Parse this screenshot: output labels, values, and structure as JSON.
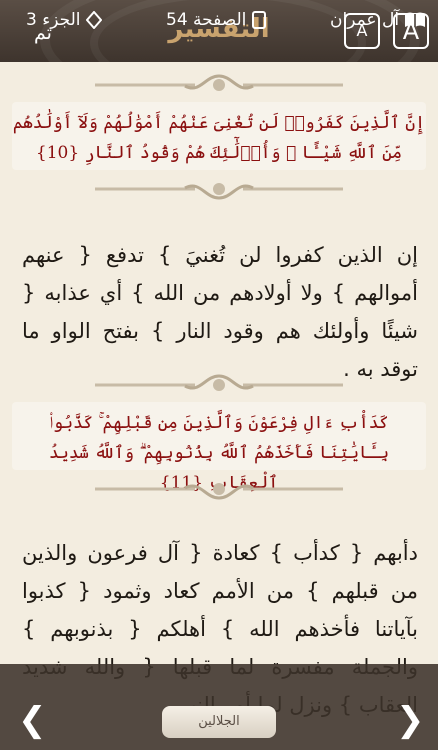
{
  "header": {
    "title": "التفسير",
    "done_label": "تم",
    "font_small_label": "A",
    "font_large_label": "A"
  },
  "verses": [
    {
      "text": "إِنَّ ٱلَّذِينَ كَفَرُوا۟ لَن تُغْنِىَ عَنْهُمْ أَمْوَٰلُهُمْ وَلَآ أَوْلَٰدُهُم مِّنَ ٱللَّهِ شَيْـًٔا ۖ وَأُو۟لَٰٓئِكَ هُمْ وَقُودُ ٱلنَّارِ",
      "number": "{10}"
    },
    {
      "text": "كَدَأْبِ ءَالِ فِرْعَوْنَ وَٱلَّذِينَ مِن قَبْلِهِمْ ۚ كَذَّبُوا۟ بِـَٔايَٰتِنَا فَأَخَذَهُمُ ٱللَّهُ بِذُنُوبِهِمْ ۗ وَٱللَّهُ شَدِيدُ ٱلْعِقَابِ",
      "number": "{11}"
    }
  ],
  "tafsir": [
    "إن الذين كفروا لن تُغنيَ } تدفع { عنهم أموالهم } ولا أولادهم من الله } أي عذابه { شيئًا وأولئك هم وقود النار } بفتح الواو ما توقد به .",
    "دأبهم { كدأب } كعادة { آل فرعون والذين من قبلهم } من الأمم كعاد وثمود { كذبوا بآياتنا فأخذهم الله } أهلكم { بذنوبهم } والجملة مفسرة لما قبلها { والله شديد العقاب } ونزل لما أمر النبي"
  ],
  "footer": {
    "surah": "آل عمران",
    "page_label": "الصفحة 54",
    "juz_label": "الجزء 3",
    "source_label": "الجلالين"
  }
}
